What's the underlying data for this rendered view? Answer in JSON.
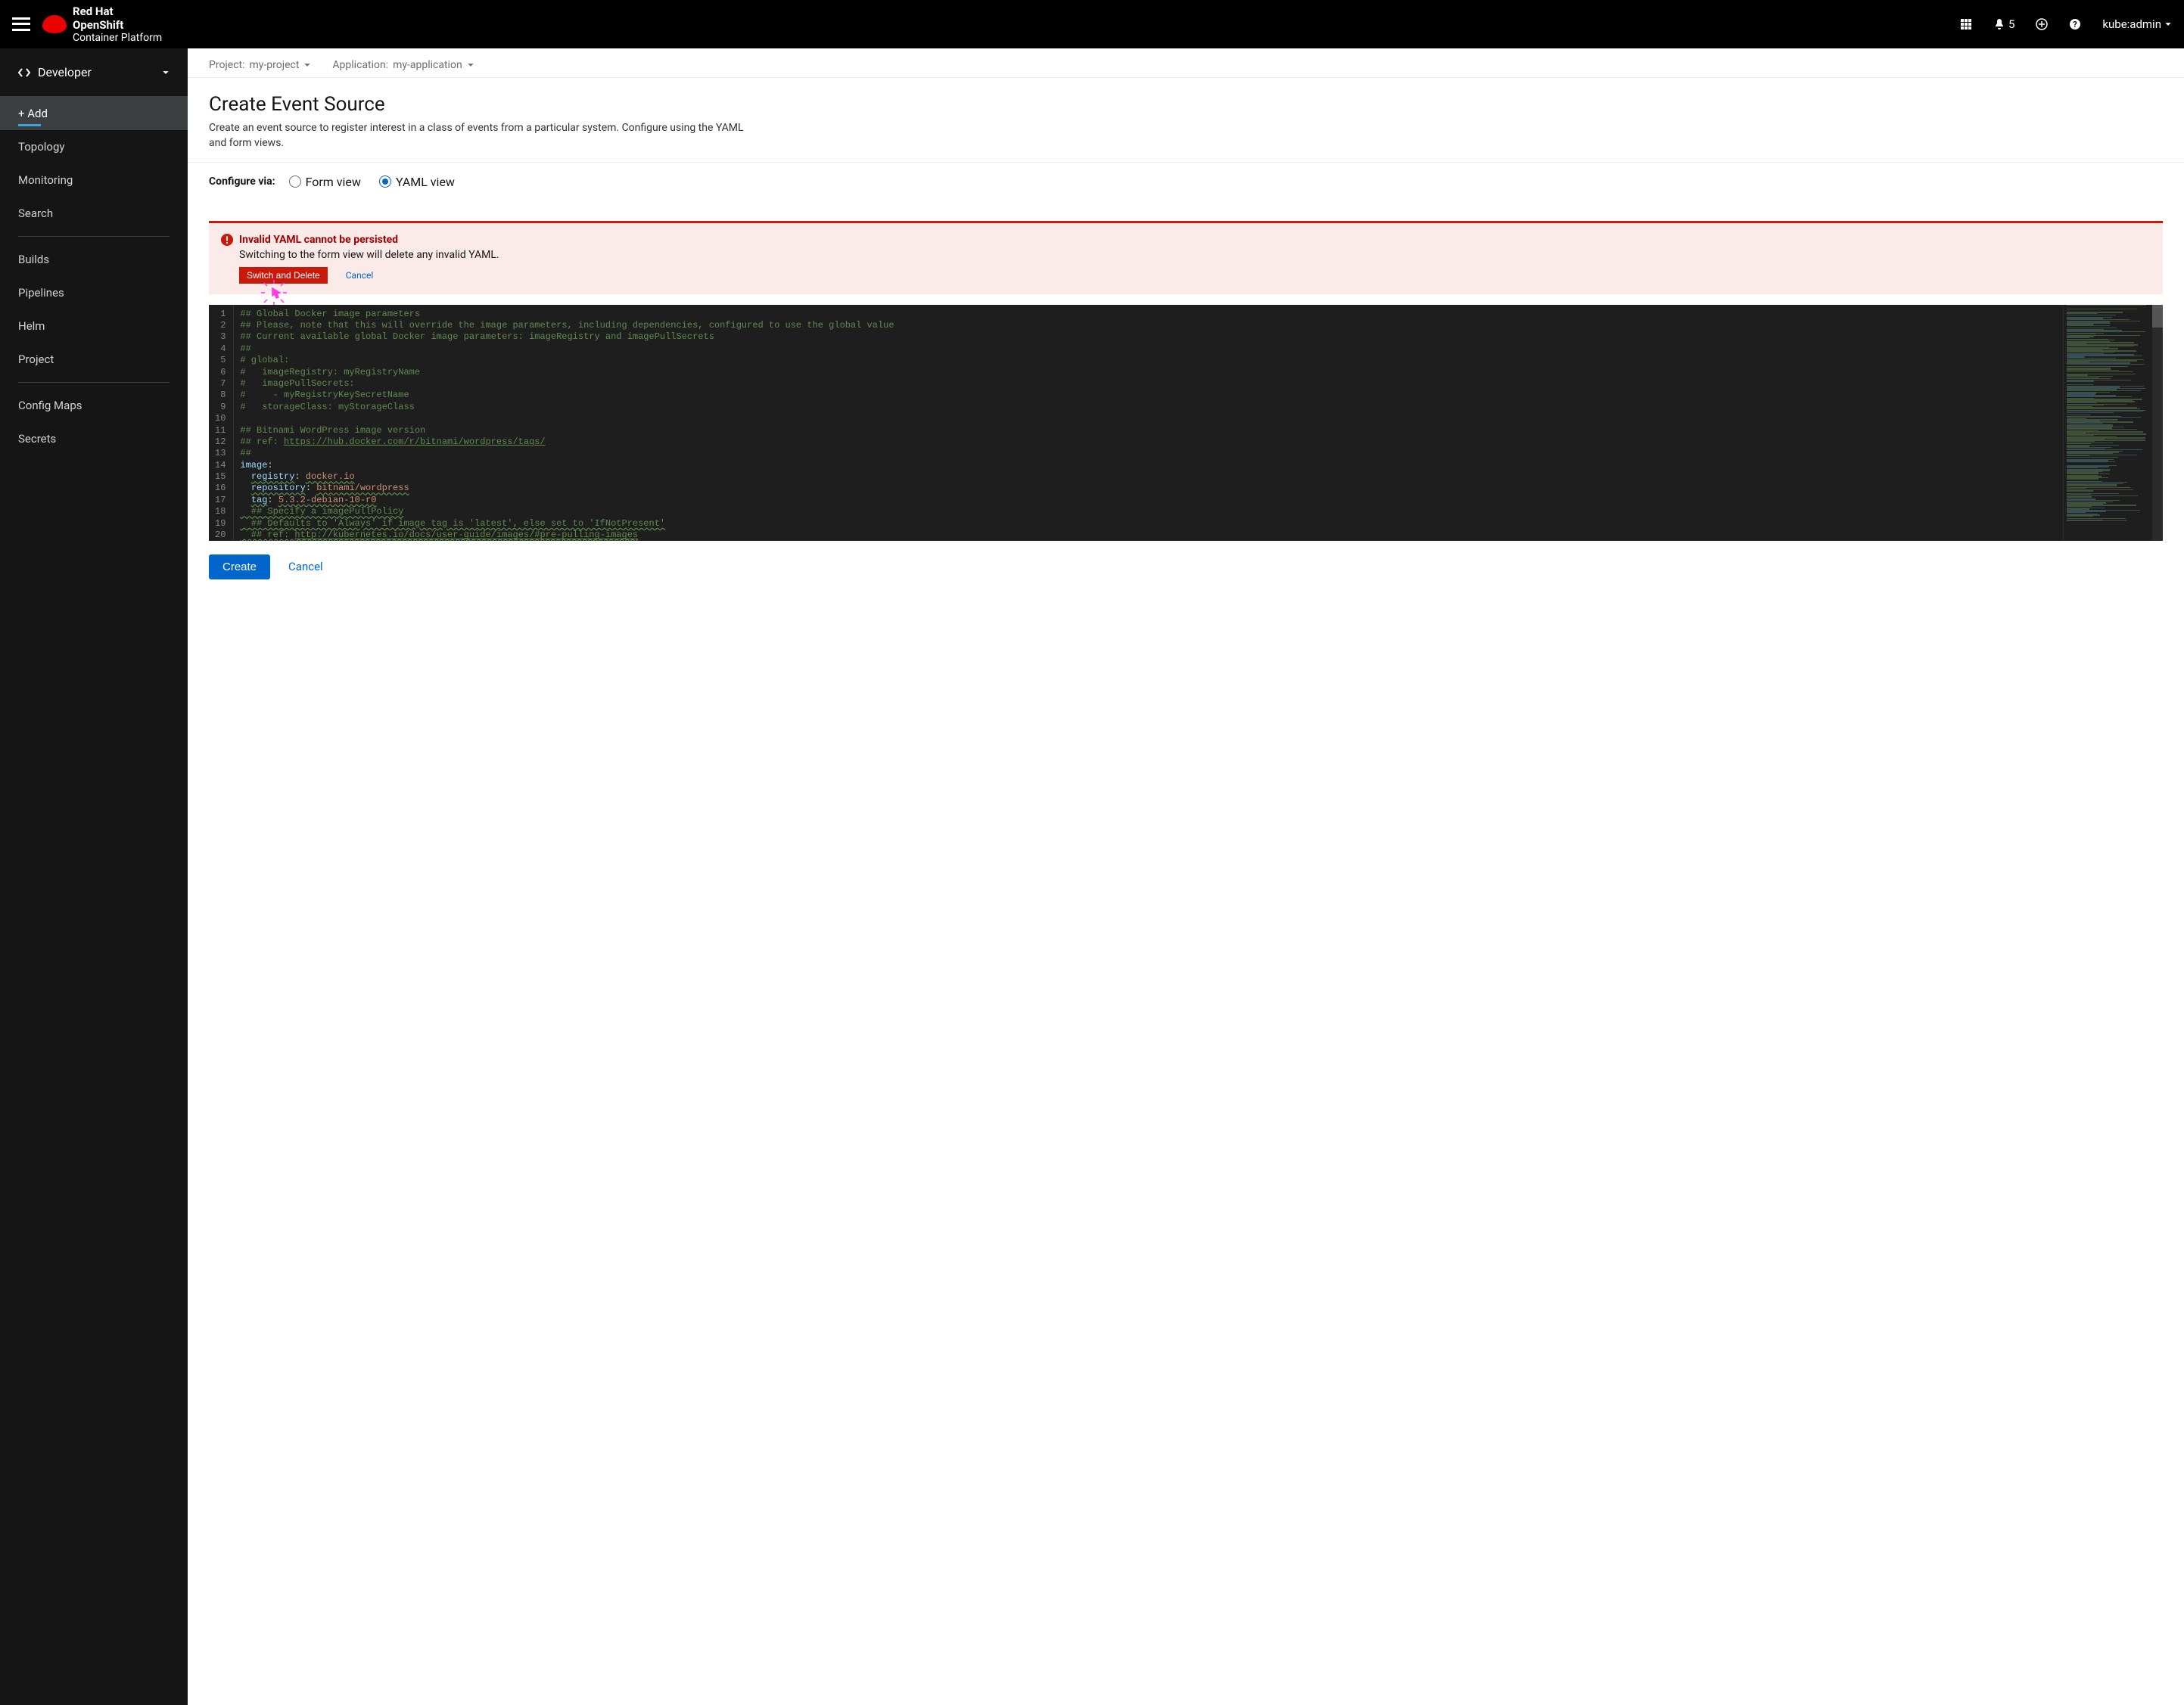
{
  "masthead": {
    "brand_top": "Red Hat",
    "brand_mid": "OpenShift",
    "brand_bottom": "Container Platform",
    "notification_count": "5",
    "user": "kube:admin"
  },
  "sidebar": {
    "perspective": "Developer",
    "group1": [
      {
        "label": "+ Add",
        "active": true
      },
      {
        "label": "Topology",
        "active": false
      },
      {
        "label": "Monitoring",
        "active": false
      },
      {
        "label": "Search",
        "active": false
      }
    ],
    "group2": [
      {
        "label": "Builds"
      },
      {
        "label": "Pipelines"
      },
      {
        "label": "Helm"
      },
      {
        "label": "Project"
      }
    ],
    "group3": [
      {
        "label": "Config Maps"
      },
      {
        "label": "Secrets"
      }
    ]
  },
  "context": {
    "project_label": "Project:",
    "project_value": "my-project",
    "application_label": "Application:",
    "application_value": "my-application"
  },
  "header": {
    "title": "Create Event Source",
    "description": "Create an event source to register interest in a class of events from a particular system. Configure using the YAML and form views."
  },
  "configure": {
    "label": "Configure via:",
    "form_view": "Form view",
    "yaml_view": "YAML view",
    "selected": "yaml"
  },
  "alert": {
    "title": "Invalid YAML cannot be persisted",
    "body": "Switching to the form view will delete any invalid YAML.",
    "switch_btn": "Switch and Delete",
    "cancel": "Cancel"
  },
  "editor": {
    "lines": [
      {
        "n": "1",
        "type": "comment",
        "text": "## Global Docker image parameters"
      },
      {
        "n": "2",
        "type": "comment",
        "text": "## Please, note that this will override the image parameters, including dependencies, configured to use the global value"
      },
      {
        "n": "3",
        "type": "comment",
        "text": "## Current available global Docker image parameters: imageRegistry and imagePullSecrets"
      },
      {
        "n": "4",
        "type": "comment",
        "text": "##"
      },
      {
        "n": "5",
        "type": "comment",
        "text": "# global:"
      },
      {
        "n": "6",
        "type": "comment",
        "text": "#   imageRegistry: myRegistryName"
      },
      {
        "n": "7",
        "type": "comment",
        "text": "#   imagePullSecrets:"
      },
      {
        "n": "8",
        "type": "comment",
        "text": "#     - myRegistryKeySecretName"
      },
      {
        "n": "9",
        "type": "comment",
        "text": "#   storageClass: myStorageClass"
      },
      {
        "n": "10",
        "type": "blank",
        "text": ""
      },
      {
        "n": "11",
        "type": "comment",
        "text": "## Bitnami WordPress image version"
      },
      {
        "n": "12",
        "type": "comment-link",
        "prefix": "## ref: ",
        "link": "https://hub.docker.com/r/bitnami/wordpress/tags/"
      },
      {
        "n": "13",
        "type": "comment",
        "text": "##"
      },
      {
        "n": "14",
        "type": "kv",
        "key": "image",
        "val": ""
      },
      {
        "n": "15",
        "type": "kv-indent",
        "key": "registry",
        "val": "docker.io"
      },
      {
        "n": "16",
        "type": "kv-indent",
        "key": "repository",
        "val": "bitnami/wordpress"
      },
      {
        "n": "17",
        "type": "kv-indent",
        "key": "tag",
        "val": "5.3.2-debian-10-r0"
      },
      {
        "n": "18",
        "type": "comment-underline",
        "text": "  ## Specify a imagePullPolicy"
      },
      {
        "n": "19",
        "type": "comment-underline",
        "text": "  ## Defaults to 'Always' if image tag is 'latest', else set to 'IfNotPresent'"
      },
      {
        "n": "20",
        "type": "comment-underline-link",
        "prefix": "  ## ref: ",
        "link": "http://kubernetes.io/docs/user-guide/images/#pre-pulling-images"
      }
    ]
  },
  "footer": {
    "create": "Create",
    "cancel": "Cancel"
  }
}
